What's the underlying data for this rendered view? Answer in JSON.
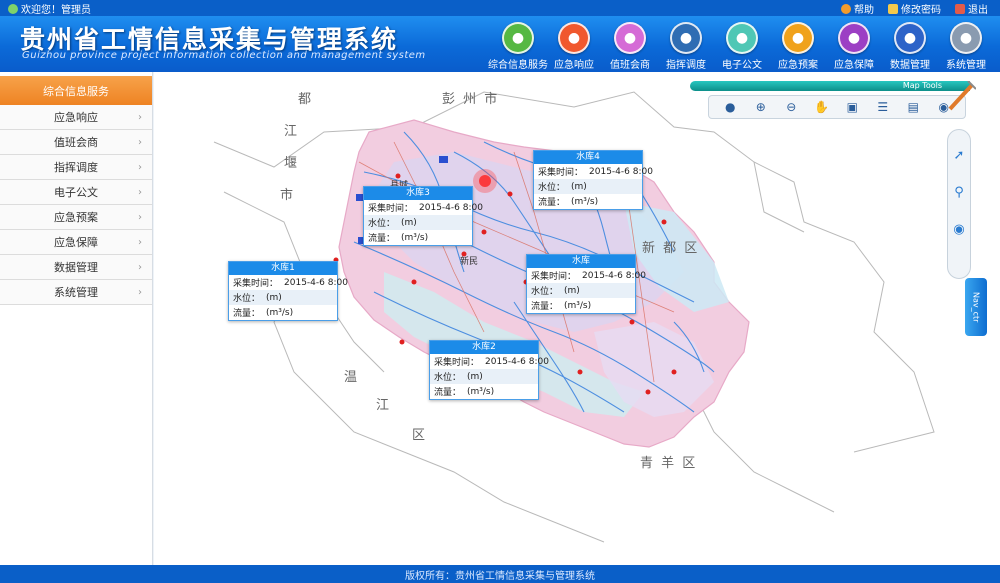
{
  "topbar": {
    "welcome": "欢迎您！管理员",
    "help": "帮助",
    "change_password": "修改密码",
    "logout": "退出"
  },
  "header": {
    "title": "贵州省工情信息采集与管理系统",
    "subtitle": "Guizhou province project information collection and management system"
  },
  "nav": [
    {
      "label": "综合信息服务",
      "icon": "monitor-icon",
      "color": "#56b843"
    },
    {
      "label": "应急响应",
      "icon": "runner-icon",
      "color": "#f0582e"
    },
    {
      "label": "值班会商",
      "icon": "user-icon",
      "color": "#d56bd6"
    },
    {
      "label": "指挥调度",
      "icon": "truck-icon",
      "color": "#2f6db3"
    },
    {
      "label": "电子公文",
      "icon": "download-icon",
      "color": "#4fc7b5"
    },
    {
      "label": "应急预案",
      "icon": "person-icon",
      "color": "#f0a21b"
    },
    {
      "label": "应急保障",
      "icon": "person-icon",
      "color": "#9c3fc4"
    },
    {
      "label": "数据管理",
      "icon": "document-icon",
      "color": "#2d63c8"
    },
    {
      "label": "系统管理",
      "icon": "gear-icon",
      "color": "#8a9bb0"
    }
  ],
  "sidebar": {
    "header": "综合信息服务",
    "items": [
      {
        "label": "应急响应"
      },
      {
        "label": "值班会商"
      },
      {
        "label": "指挥调度"
      },
      {
        "label": "电子公文"
      },
      {
        "label": "应急预案"
      },
      {
        "label": "应急保障"
      },
      {
        "label": "数据管理"
      },
      {
        "label": "系统管理"
      }
    ]
  },
  "map": {
    "tools_title": "Map Tools",
    "side_tab": "Nav_ctr",
    "region_labels": {
      "pengzhou": "彭 州 市",
      "du": "都",
      "jiang": "江",
      "yan": "堰",
      "shi": "市",
      "xindu": "新 都 区",
      "wen": "温",
      "jiang2": "江",
      "qu": "区",
      "qingyang": "青 羊 区"
    },
    "city_labels": [
      "县城",
      "新民"
    ],
    "popups": [
      {
        "title": "水库4",
        "rows": [
          {
            "k": "采集时间：",
            "v": "2015-4-6 8:00"
          },
          {
            "k": "水位：",
            "v": "(m)"
          },
          {
            "k": "流量：",
            "v": "(m³/s)"
          }
        ]
      },
      {
        "title": "水库3",
        "rows": [
          {
            "k": "采集时间：",
            "v": "2015-4-6 8:00"
          },
          {
            "k": "水位：",
            "v": "(m)"
          },
          {
            "k": "流量：",
            "v": "(m³/s)"
          }
        ]
      },
      {
        "title": "水库1",
        "rows": [
          {
            "k": "采集时间：",
            "v": "2015-4-6 8:00"
          },
          {
            "k": "水位：",
            "v": "(m)"
          },
          {
            "k": "流量：",
            "v": "(m³/s)"
          }
        ]
      },
      {
        "title": "水库",
        "rows": [
          {
            "k": "采集时间：",
            "v": "2015-4-6 8:00"
          },
          {
            "k": "水位：",
            "v": "(m)"
          },
          {
            "k": "流量：",
            "v": "(m³/s)"
          }
        ]
      },
      {
        "title": "水库2",
        "rows": [
          {
            "k": "采集时间：",
            "v": "2015-4-6 8:00"
          },
          {
            "k": "水位：",
            "v": "(m)"
          },
          {
            "k": "流量：",
            "v": "(m³/s)"
          }
        ]
      }
    ]
  },
  "footer": {
    "copyright": "版权所有：贵州省工情信息采集与管理系统"
  }
}
